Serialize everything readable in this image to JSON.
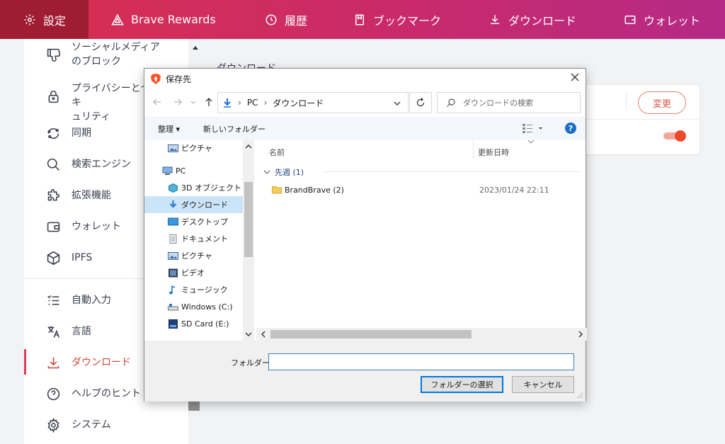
{
  "topbar": {
    "tabs": [
      {
        "label": "設定",
        "icon": "gear-icon"
      },
      {
        "label": "Brave Rewards",
        "icon": "triangle-icon"
      },
      {
        "label": "履歴",
        "icon": "history-icon"
      },
      {
        "label": "ブックマーク",
        "icon": "bookmark-icon"
      },
      {
        "label": "ダウンロード",
        "icon": "download-icon"
      },
      {
        "label": "ウォレット",
        "icon": "wallet-icon"
      }
    ]
  },
  "sidebar": {
    "items": [
      {
        "label": "ソーシャルメディア\nのブロック",
        "icon": "thumbs-down-icon"
      },
      {
        "label": "プライバシーとセキ\nュリティ",
        "icon": "lock-icon"
      },
      {
        "label": "同期",
        "icon": "sync-icon"
      },
      {
        "label": "検索エンジン",
        "icon": "search-icon"
      },
      {
        "label": "拡張機能",
        "icon": "puzzle-icon"
      },
      {
        "label": "ウォレット",
        "icon": "wallet-icon"
      },
      {
        "label": "IPFS",
        "icon": "cube-icon"
      },
      {
        "label": "自動入力",
        "icon": "list-check-icon"
      },
      {
        "label": "言語",
        "icon": "translate-icon"
      },
      {
        "label": "ダウンロード",
        "icon": "download-icon"
      },
      {
        "label": "ヘルプのヒント",
        "icon": "help-circle-icon"
      },
      {
        "label": "システム",
        "icon": "gear-icon"
      }
    ],
    "active": "ダウンロード"
  },
  "content": {
    "heading": "ダウンロード",
    "change_button": "変更",
    "toggle_on": true,
    "accent": "#e03a57"
  },
  "dialog": {
    "title": "保存先",
    "breadcrumb": [
      "PC",
      "ダウンロード"
    ],
    "search_placeholder": "ダウンロードの検索",
    "organize": "整理 ▾",
    "new_folder": "新しいフォルダー",
    "help": "?",
    "tree": [
      {
        "label": "ピクチャ",
        "icon": "pictures-icon"
      },
      {
        "label": "PC",
        "icon": "pc-icon"
      },
      {
        "label": "3D オブジェクト",
        "icon": "3d-objects-icon"
      },
      {
        "label": "ダウンロード",
        "icon": "downloads-folder-icon"
      },
      {
        "label": "デスクトップ",
        "icon": "desktop-icon"
      },
      {
        "label": "ドキュメント",
        "icon": "documents-icon"
      },
      {
        "label": "ピクチャ",
        "icon": "pictures-icon"
      },
      {
        "label": "ビデオ",
        "icon": "videos-icon"
      },
      {
        "label": "ミュージック",
        "icon": "music-icon"
      },
      {
        "label": "Windows (C:)",
        "icon": "drive-icon"
      },
      {
        "label": "SD Card (E:)",
        "icon": "sd-card-icon"
      }
    ],
    "columns": {
      "name": "名前",
      "modified": "更新日時"
    },
    "group": "先週 (1)",
    "files": [
      {
        "name": "BrandBrave (2)",
        "modified": "2023/01/24 22:11"
      }
    ],
    "folder_label": "フォルダー:",
    "folder_value": "",
    "select_button": "フォルダーの選択",
    "cancel_button": "キャンセル"
  }
}
